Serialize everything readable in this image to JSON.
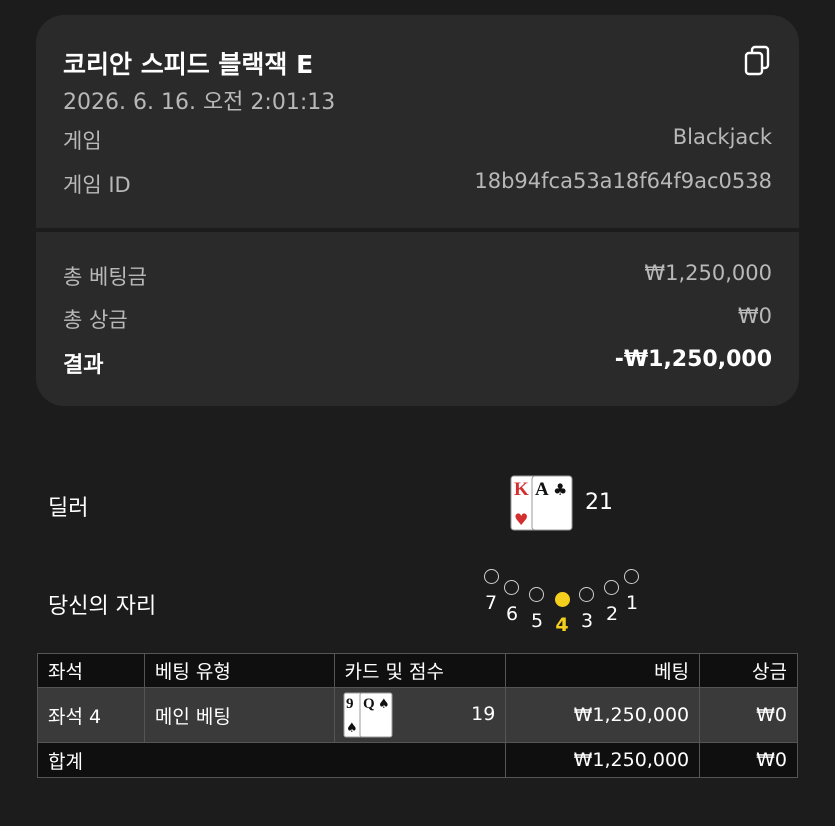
{
  "header": {
    "title": "코리안 스피드 블랙잭 E",
    "datetime": "2026. 6. 16. 오전 2:01:13"
  },
  "details": {
    "game_label": "게임",
    "game_value": "Blackjack",
    "game_id_label": "게임 ID",
    "game_id_value": "18b94fca53a18f64f9ac0538"
  },
  "summary": {
    "total_bet_label": "총 베팅금",
    "total_bet_value": "₩1,250,000",
    "total_win_label": "총 상금",
    "total_win_value": "₩0",
    "result_label": "결과",
    "result_value": "-₩1,250,000"
  },
  "dealer": {
    "label": "딜러",
    "cards": [
      {
        "rank": "K",
        "suit": "♥"
      },
      {
        "rank": "A",
        "suit": "♣"
      }
    ],
    "score": "21"
  },
  "seats": {
    "label": "당신의 자리",
    "numbers": [
      "7",
      "6",
      "5",
      "4",
      "3",
      "2",
      "1"
    ],
    "active": "4"
  },
  "table": {
    "headers": [
      "좌석",
      "베팅 유형",
      "카드 및 점수",
      "베팅",
      "상금"
    ],
    "row": {
      "seat": "좌석 4",
      "bet_type": "메인 베팅",
      "cards": [
        {
          "rank": "9",
          "suit": "♠"
        },
        {
          "rank": "Q",
          "suit": "♠"
        }
      ],
      "score": "19",
      "bet": "₩1,250,000",
      "win": "₩0"
    },
    "total": {
      "label": "합계",
      "bet": "₩1,250,000",
      "win": "₩0"
    }
  },
  "colors": {
    "background": "#1c1c1c",
    "card": "#2a2a2a",
    "active_seat": "#f4cf1d",
    "heart_red": "#d32f2f"
  }
}
